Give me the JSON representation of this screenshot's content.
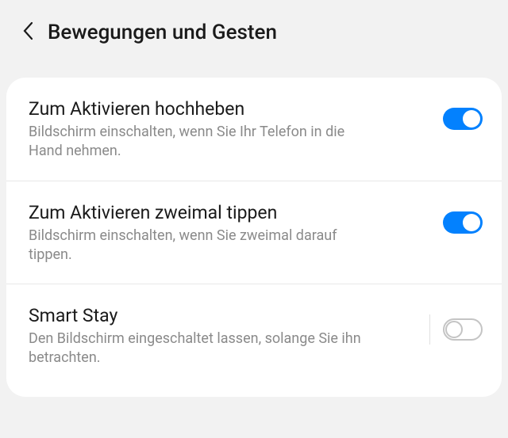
{
  "header": {
    "title": "Bewegungen und Gesten"
  },
  "settings": {
    "lift_to_wake": {
      "title": "Zum Aktivieren hochheben",
      "desc": "Bildschirm einschalten, wenn Sie Ihr Telefon in die Hand nehmen.",
      "enabled": true
    },
    "double_tap": {
      "title": "Zum Aktivieren zweimal tippen",
      "desc": "Bildschirm einschalten, wenn Sie zweimal darauf tippen.",
      "enabled": true
    },
    "smart_stay": {
      "title": "Smart Stay",
      "desc": "Den Bildschirm eingeschaltet lassen, solange Sie ihn betrachten.",
      "enabled": false
    }
  }
}
